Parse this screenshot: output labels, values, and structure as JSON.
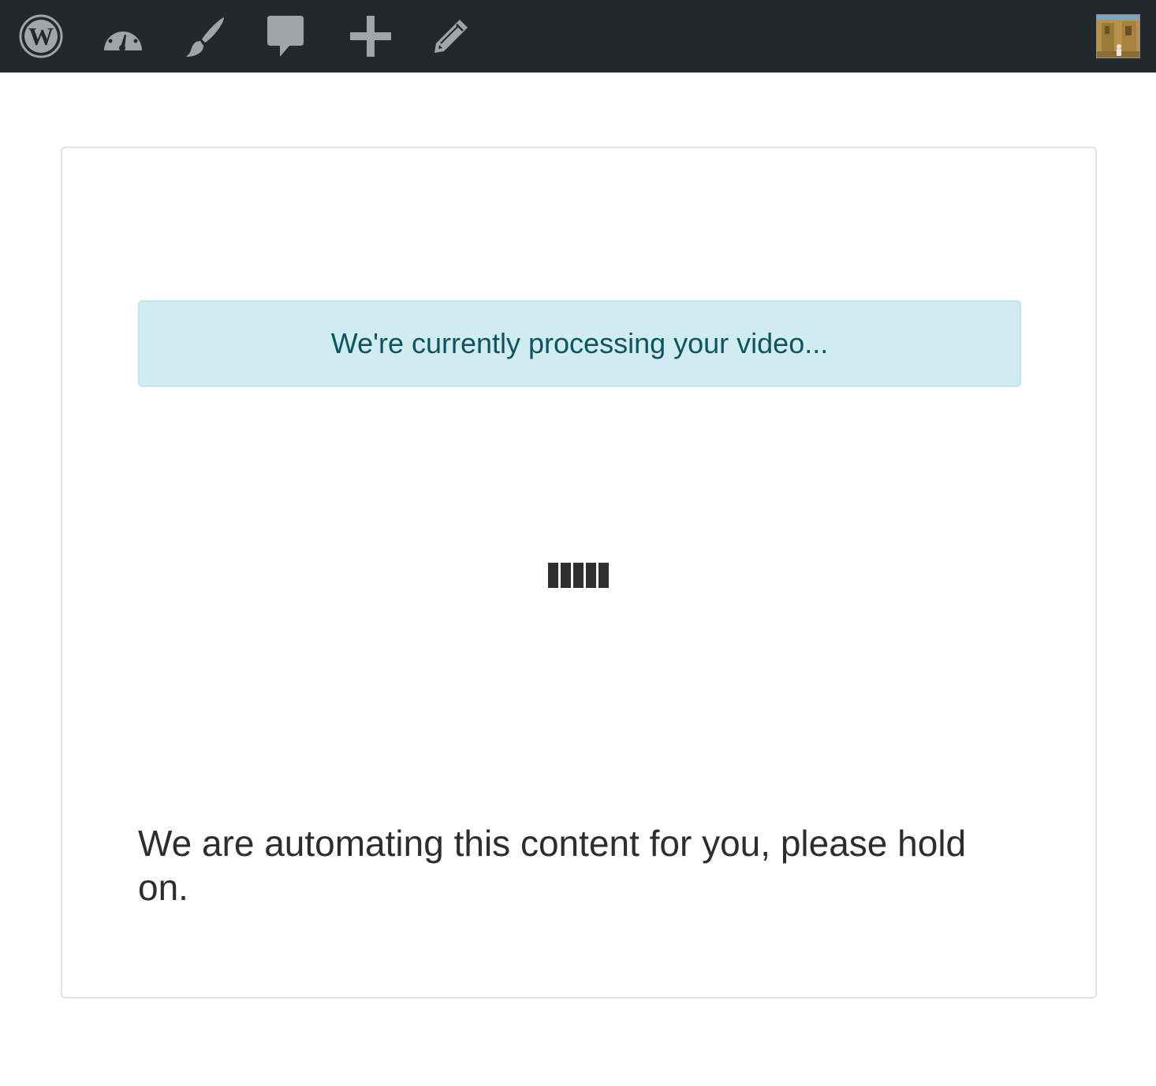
{
  "admin_bar": {
    "items": [
      {
        "name": "wordpress-logo-icon",
        "title": "WordPress"
      },
      {
        "name": "dashboard-icon",
        "title": "Dashboard"
      },
      {
        "name": "customize-brush-icon",
        "title": "Customize"
      },
      {
        "name": "comments-icon",
        "title": "Comments"
      },
      {
        "name": "new-content-plus-icon",
        "title": "New"
      },
      {
        "name": "edit-pencil-icon",
        "title": "Edit"
      }
    ],
    "icon_color": "#a0a5aa",
    "background": "#23282d"
  },
  "card": {
    "alert_text": "We're currently processing your video...",
    "message": "We are automating this content for you, please hold on.",
    "loader_bars": 5
  },
  "colors": {
    "alert_bg": "#d1ecf1",
    "alert_border": "#bee5eb",
    "alert_text": "#0c5460",
    "message_text": "#2d2d2d"
  }
}
